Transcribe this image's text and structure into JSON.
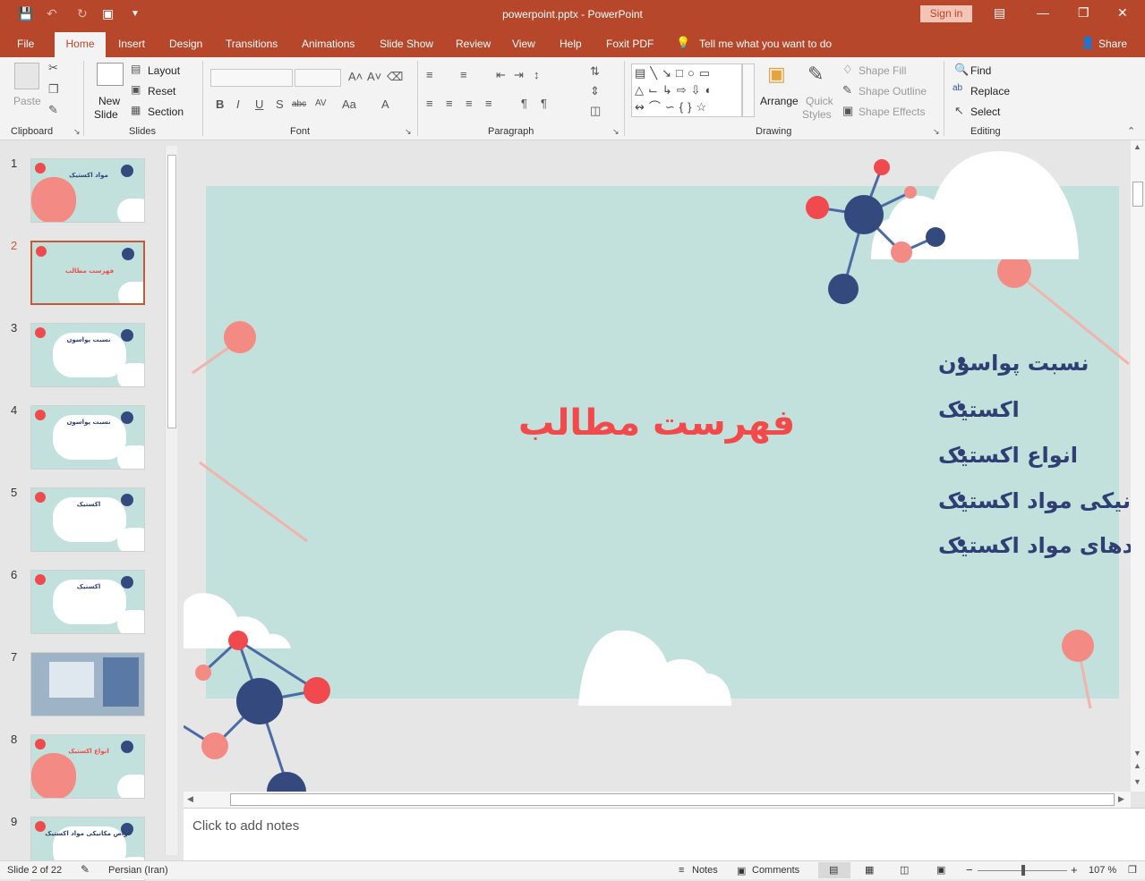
{
  "window": {
    "title": "powerpoint.pptx  -  PowerPoint",
    "signin_label": "Sign in"
  },
  "tabs": [
    "File",
    "Home",
    "Insert",
    "Design",
    "Transitions",
    "Animations",
    "Slide Show",
    "Review",
    "View",
    "Help",
    "Foxit PDF"
  ],
  "tell_me": "Tell me what you want to do",
  "share_label": "Share",
  "ribbon": {
    "clipboard": {
      "label": "Clipboard",
      "paste": "Paste"
    },
    "slides": {
      "label": "Slides",
      "new_slide_1": "New",
      "new_slide_2": "Slide",
      "layout": "Layout",
      "reset": "Reset",
      "section": "Section"
    },
    "font": {
      "label": "Font",
      "bold": "B",
      "italic": "I",
      "underline": "U",
      "shadow": "S",
      "strike": "abc",
      "spacing": "AV",
      "case": "Aa"
    },
    "paragraph": {
      "label": "Paragraph"
    },
    "drawing": {
      "label": "Drawing",
      "arrange": "Arrange",
      "quick_1": "Quick",
      "quick_2": "Styles",
      "shape_fill": "Shape Fill",
      "shape_outline": "Shape Outline",
      "shape_effects": "Shape Effects"
    },
    "editing": {
      "label": "Editing",
      "find": "Find",
      "replace": "Replace",
      "select": "Select"
    }
  },
  "thumbnails": [
    {
      "n": "1",
      "caption": "مواد اکستیک"
    },
    {
      "n": "2",
      "caption": "فهرست مطالب"
    },
    {
      "n": "3",
      "caption": "نسبت پواسون"
    },
    {
      "n": "4",
      "caption": "نسبت پواسون"
    },
    {
      "n": "5",
      "caption": "اکستیک"
    },
    {
      "n": "6",
      "caption": "اکستیک"
    },
    {
      "n": "7",
      "caption": ""
    },
    {
      "n": "8",
      "caption": "انواع اکستیک"
    },
    {
      "n": "9",
      "caption": "خواص مکانیکی مواد اکستیک"
    }
  ],
  "selected_slide": 2,
  "slide": {
    "title": "فهرست مطالب",
    "bullets": [
      "نسبت پواسون",
      "اکستیک",
      "انواع اکستیک",
      "خواص مکانیکی مواد اکستیک",
      "مثال هایی از کاربردهای مواد اکستیک"
    ],
    "colors": {
      "bg": "#c2e1dc",
      "title": "#f24a4a",
      "text": "#2f3f73",
      "navy": "#344a7f",
      "red": "#f04a4f",
      "salmon": "#f38a84"
    }
  },
  "notes_placeholder": "Click to add notes",
  "status": {
    "slide": "Slide 2 of 22",
    "language": "Persian (Iran)",
    "notes": "Notes",
    "comments": "Comments",
    "zoom": "107 %"
  }
}
